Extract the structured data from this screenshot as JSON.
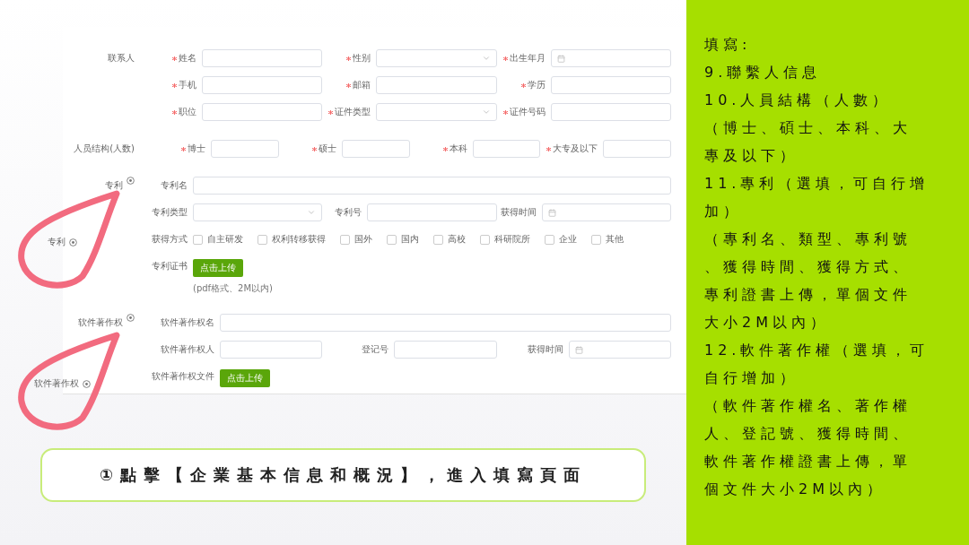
{
  "form": {
    "sections": [
      {
        "label": "联系人",
        "addable": false,
        "rows": [
          [
            {
              "kind": "text",
              "label": "姓名",
              "required": true
            },
            {
              "kind": "select",
              "label": "性别",
              "required": true
            },
            {
              "kind": "date",
              "label": "出生年月",
              "required": true
            }
          ],
          [
            {
              "kind": "text",
              "label": "手机",
              "required": true
            },
            {
              "kind": "text",
              "label": "邮箱",
              "required": true
            },
            {
              "kind": "text",
              "label": "学历",
              "required": true
            }
          ],
          [
            {
              "kind": "text",
              "label": "职位",
              "required": true
            },
            {
              "kind": "select",
              "label": "证件类型",
              "required": true
            },
            {
              "kind": "text",
              "label": "证件号码",
              "required": true
            }
          ]
        ]
      },
      {
        "label": "人员结构(人数)",
        "addable": false,
        "rows": [
          [
            {
              "kind": "text",
              "label": "博士",
              "required": true
            },
            {
              "kind": "text",
              "label": "硕士",
              "required": true
            },
            {
              "kind": "text",
              "label": "本科",
              "required": true
            },
            {
              "kind": "text",
              "label": "大专及以下",
              "required": true
            }
          ]
        ]
      },
      {
        "label": "专利",
        "addable": true,
        "rows": [
          [
            {
              "kind": "text",
              "label": "专利名",
              "required": false
            }
          ],
          [
            {
              "kind": "select",
              "label": "专利类型",
              "required": false
            },
            {
              "kind": "text",
              "label": "专利号",
              "required": false
            },
            {
              "kind": "date",
              "label": "获得时间",
              "required": false
            }
          ],
          [
            {
              "kind": "checkboxes",
              "label": "获得方式",
              "required": false,
              "options": [
                {
                  "label": "自主研发",
                  "checked": false
                },
                {
                  "label": "权利转移获得",
                  "checked": false
                },
                {
                  "label": "国外",
                  "checked": false
                },
                {
                  "label": "国内",
                  "checked": false
                },
                {
                  "label": "高校",
                  "checked": false
                },
                {
                  "label": "科研院所",
                  "checked": false
                },
                {
                  "label": "企业",
                  "checked": false
                },
                {
                  "label": "其他",
                  "checked": false
                }
              ]
            }
          ],
          [
            {
              "kind": "upload",
              "label": "专利证书",
              "required": false,
              "button": "点击上传",
              "hint": "(pdf格式、2M以内)"
            }
          ]
        ]
      },
      {
        "label": "软件著作权",
        "addable": true,
        "rows": [
          [
            {
              "kind": "text",
              "label": "软件著作权名",
              "required": false
            }
          ],
          [
            {
              "kind": "text",
              "label": "软件著作权人",
              "required": false
            },
            {
              "kind": "text",
              "label": "登记号",
              "required": false
            },
            {
              "kind": "date",
              "label": "获得时间",
              "required": false
            }
          ],
          [
            {
              "kind": "upload",
              "label": "软件著作权文件",
              "required": false,
              "button": "点击上传"
            }
          ]
        ]
      }
    ]
  },
  "callouts": [
    {
      "label": "专利"
    },
    {
      "label": "软件著作权"
    }
  ],
  "banner": "①點擊【企業基本信息和概況】，進入填寫頁面",
  "notes": [
    "填寫:",
    "9.聯繫人信息",
    "10.人員結構（人數）",
    "（博士、碩士、本科、大",
    "專及以下）",
    "11.專利（選填，可自行增",
    "加）",
    "（專利名、類型、專利號",
    "、獲得時間、獲得方式、",
    "專利證書上傳，單個文件",
    "大小2M以內）",
    "12.軟件著作權（選填，可",
    "自行增加）",
    "（軟件著作權名、著作權",
    "人、登記號、獲得時間、",
    "軟件著作權證書上傳，單",
    "個文件大小2M以內）"
  ]
}
